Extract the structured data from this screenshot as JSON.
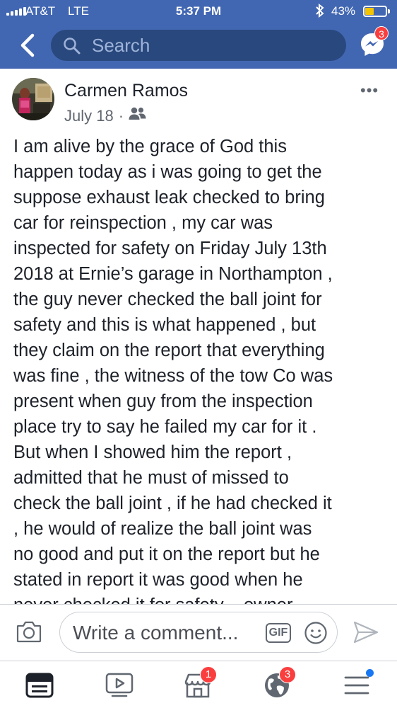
{
  "status_bar": {
    "carrier": "AT&T",
    "network": "LTE",
    "time": "5:37 PM",
    "battery_percent": "43%",
    "battery_level": 0.43,
    "bluetooth_icon": "bluetooth-icon"
  },
  "header": {
    "back_icon": "chevron-left-icon",
    "search_placeholder": "Search",
    "messenger_badge": "3"
  },
  "post": {
    "author": "Carmen Ramos",
    "date": "July 18",
    "separator": "·",
    "audience_icon": "friends-icon",
    "more_icon": "•••",
    "body": "I am alive by the grace of God this\nhappen today as i was going to get the\nsuppose exhaust leak checked to bring\ncar for reinspection , my car was\ninspected for safety on Friday  July 13th\n2018 at Ernie’s garage in Northampton ,\nthe guy never checked the ball joint for\nsafety and this is what happened , but\nthey claim on the report that everything\nwas fine ,  the witness of the tow Co was\npresent when guy from the inspection\nplace try to say he failed my car for it .\nBut when I showed him the report ,\nadmitted that he must of missed to\ncheck the ball joint ,  if  he had checked it\n, he would  of realize the ball  joint  was\nno good and put it on the report but he\nstated in report it was good when he\nnever checked it for safety .. owner"
  },
  "comment_bar": {
    "placeholder": "Write a comment...",
    "gif_label": "GIF"
  },
  "tab_bar": {
    "tabs": [
      {
        "name": "news-feed",
        "badge": ""
      },
      {
        "name": "watch",
        "badge": ""
      },
      {
        "name": "marketplace",
        "badge": "1"
      },
      {
        "name": "notifications",
        "badge": "3"
      },
      {
        "name": "menu",
        "badge": ""
      }
    ]
  },
  "colors": {
    "brand": "#4267b2",
    "search_bg": "#29487d",
    "badge": "#fa3e3e",
    "active_tab": "#1d2129",
    "inactive_tab": "#606770"
  }
}
